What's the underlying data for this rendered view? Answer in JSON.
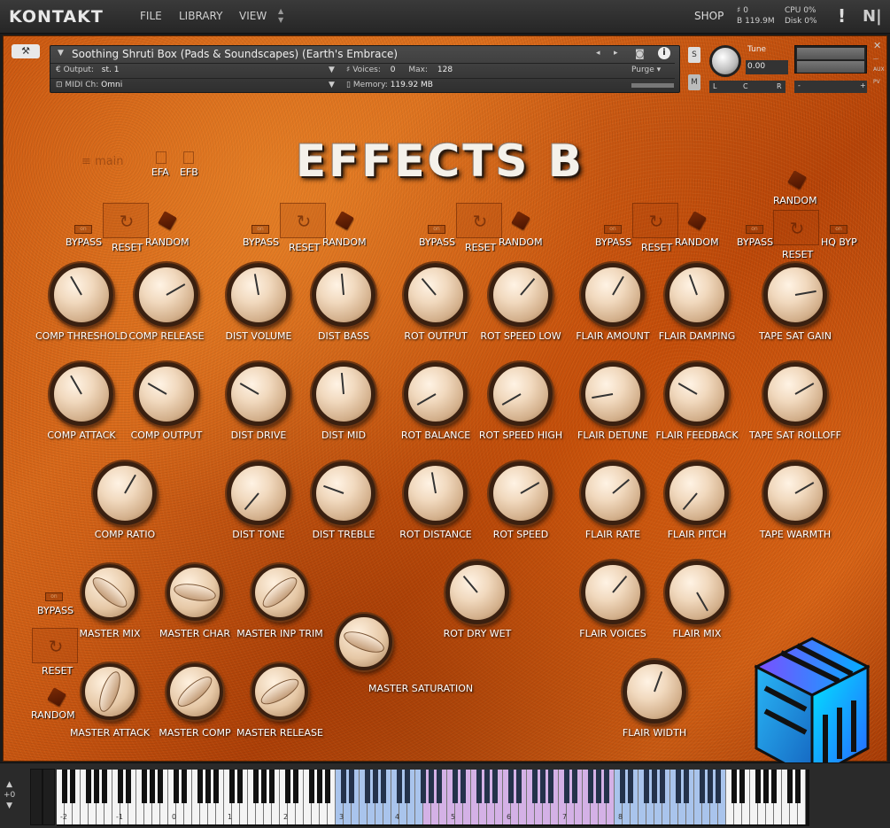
{
  "app": {
    "logo": "KONTAKT",
    "menu": [
      "FILE",
      "LIBRARY",
      "VIEW"
    ],
    "shop": "SHOP",
    "stats": {
      "voices_icon": "♯",
      "voices": "0",
      "mem_icon": "B",
      "memory": "119.9M",
      "cpu_label": "CPU",
      "cpu": "0%",
      "disk_label": "Disk",
      "disk": "0%"
    },
    "warn": "!",
    "ni": "N|"
  },
  "instrument": {
    "name": "Soothing Shruti Box (Pads & Soundscapes) (Earth's Embrace)",
    "output_label": "Output:",
    "output_value": "st. 1",
    "voices_label": "Voices:",
    "voices_value": "0",
    "max_label": "Max:",
    "max_value": "128",
    "purge": "Purge",
    "midi_label": "MIDI Ch:",
    "midi_value": "Omni",
    "memory_label": "Memory:",
    "memory_value": "119.92 MB",
    "s": "S",
    "m": "M",
    "tune_label": "Tune",
    "tune_value": "0.00",
    "l": "L",
    "c": "C",
    "r": "R",
    "aux": "AUX",
    "pv": "PV",
    "minus": "-",
    "plus": "+"
  },
  "panel": {
    "title": "EFFECTS B",
    "main_ghost": "≡ main",
    "efa": "EFA",
    "efb": "EFB",
    "random_top": "RANDOM",
    "hq_byp": "HQ BYP",
    "bypass": "BYPASS",
    "reset": "RESET",
    "random": "RANDOM",
    "on": "on"
  },
  "knobs": {
    "comp_threshold": "COMP THRESHOLD",
    "comp_release": "COMP RELEASE",
    "comp_attack": "COMP ATTACK",
    "comp_output": "COMP OUTPUT",
    "comp_ratio": "COMP RATIO",
    "dist_volume": "DIST VOLUME",
    "dist_bass": "DIST BASS",
    "dist_drive": "DIST DRIVE",
    "dist_mid": "DIST MID",
    "dist_tone": "DIST TONE",
    "dist_treble": "DIST TREBLE",
    "rot_output": "ROT OUTPUT",
    "rot_speed_low": "ROT SPEED LOW",
    "rot_balance": "ROT BALANCE",
    "rot_speed_high": "ROT SPEED HIGH",
    "rot_distance": "ROT DISTANCE",
    "rot_speed": "ROT SPEED",
    "rot_dry_wet": "ROT DRY WET",
    "flair_amount": "FLAIR AMOUNT",
    "flair_damping": "FLAIR DAMPING",
    "flair_detune": "FLAIR DETUNE",
    "flair_feedback": "FLAIR FEEDBACK",
    "flair_rate": "FLAIR RATE",
    "flair_pitch": "FLAIR PITCH",
    "flair_voices": "FLAIR VOICES",
    "flair_mix": "FLAIR MIX",
    "flair_width": "FLAIR WIDTH",
    "tape_sat_gain": "TAPE SAT GAIN",
    "tape_sat_rolloff": "TAPE SAT ROLLOFF",
    "tape_warmth": "TAPE WARMTH",
    "master_mix": "MASTER MIX",
    "master_char": "MASTER CHAR",
    "master_inp_trim": "MASTER INP TRIM",
    "master_saturation": "MASTER SATURATION",
    "master_attack": "MASTER ATTACK",
    "master_comp": "MASTER COMP",
    "master_release": "MASTER RELEASE"
  },
  "keyboard": {
    "octave_shift": "+0",
    "octaves": [
      "-2",
      "-1",
      "0",
      "1",
      "2",
      "3",
      "4",
      "5",
      "6",
      "7",
      "8"
    ]
  }
}
